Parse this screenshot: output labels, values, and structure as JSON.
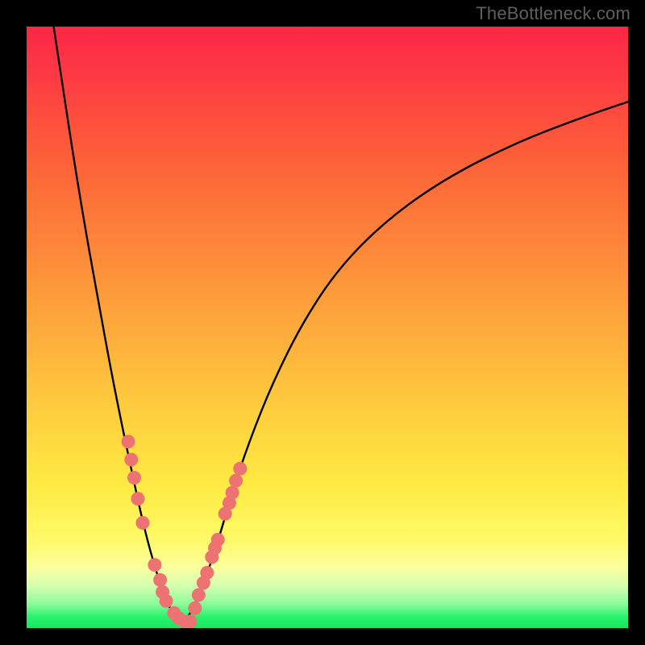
{
  "watermark": "TheBottleneck.com",
  "chart_data": {
    "type": "line",
    "title": "",
    "xlabel": "",
    "ylabel": "",
    "xlim": [
      0,
      100
    ],
    "ylim": [
      0,
      100
    ],
    "grid": false,
    "legend": false,
    "series": [
      {
        "name": "left-branch",
        "color": "#000000",
        "x": [
          4.5,
          6,
          8,
          10,
          12,
          14,
          16,
          17.5,
          19,
          20.5,
          22,
          23,
          24,
          25,
          26
        ],
        "y": [
          100,
          90,
          77,
          65,
          54,
          43,
          33,
          26,
          19,
          13,
          8,
          5,
          3,
          1.5,
          0.8
        ]
      },
      {
        "name": "right-branch",
        "color": "#000000",
        "x": [
          26,
          27,
          28.5,
          30,
          32,
          34,
          37,
          41,
          46,
          52,
          60,
          70,
          82,
          94,
          100
        ],
        "y": [
          0.8,
          2,
          5,
          9,
          15,
          22,
          31,
          41,
          51,
          60,
          68,
          75,
          81,
          85.5,
          87.5
        ]
      }
    ],
    "marker_clusters": [
      {
        "name": "left-cluster",
        "color": "#ec7372",
        "points": [
          [
            16.9,
            31
          ],
          [
            17.4,
            28
          ],
          [
            17.9,
            25
          ],
          [
            18.5,
            21.5
          ],
          [
            19.3,
            17.5
          ],
          [
            21.3,
            10.5
          ],
          [
            22.2,
            8
          ],
          [
            22.6,
            6
          ],
          [
            23.2,
            4.5
          ],
          [
            24.5,
            2.5
          ],
          [
            25.2,
            1.7
          ],
          [
            26.2,
            1.1
          ],
          [
            27.2,
            1.1
          ]
        ]
      },
      {
        "name": "right-cluster",
        "color": "#ec7372",
        "points": [
          [
            28.0,
            3.3
          ],
          [
            28.6,
            5.5
          ],
          [
            29.4,
            7.5
          ],
          [
            30.0,
            9.2
          ],
          [
            30.8,
            11.8
          ],
          [
            31.3,
            13.3
          ],
          [
            31.8,
            14.7
          ],
          [
            33.0,
            19.0
          ],
          [
            33.7,
            20.8
          ],
          [
            34.2,
            22.5
          ],
          [
            34.8,
            24.5
          ],
          [
            35.5,
            26.5
          ]
        ]
      }
    ]
  }
}
